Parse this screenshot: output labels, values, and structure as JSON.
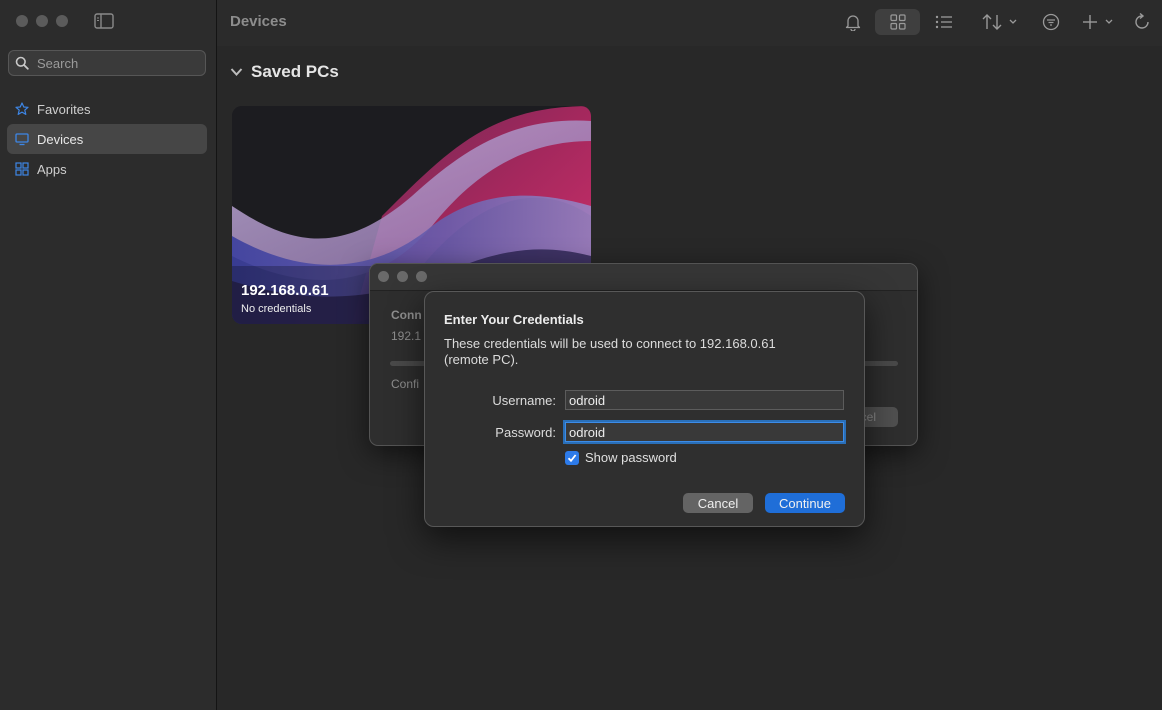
{
  "sidebar": {
    "search_placeholder": "Search",
    "items": [
      {
        "label": "Favorites",
        "icon": "star-icon",
        "active": false
      },
      {
        "label": "Devices",
        "icon": "monitor-icon",
        "active": true
      },
      {
        "label": "Apps",
        "icon": "apps-grid-icon",
        "active": false
      }
    ]
  },
  "toolbar": {
    "title": "Devices",
    "icons": [
      "bell-icon",
      "grid-view-icon",
      "list-view-icon",
      "sort-icon",
      "filter-icon",
      "add-icon",
      "refresh-icon"
    ]
  },
  "main": {
    "section_title": "Saved PCs",
    "pc_card": {
      "name": "192.168.0.61",
      "status": "No credentials"
    }
  },
  "background_window": {
    "label_connecting": "Conn",
    "label_address": "192.1",
    "label_configuring": "Confi",
    "cancel_label": "ncel"
  },
  "dialog": {
    "title": "Enter Your Credentials",
    "message": "These credentials will be used to connect to 192.168.0.61 (remote PC).",
    "username_label": "Username:",
    "username_value": "odroid",
    "password_label": "Password:",
    "password_value": "odroid",
    "show_password_label": "Show password",
    "show_password_checked": true,
    "cancel_label": "Cancel",
    "continue_label": "Continue"
  },
  "colors": {
    "accent": "#1f6ed8",
    "checkbox": "#2d7bea",
    "focus_ring": "#3c8ce8"
  }
}
